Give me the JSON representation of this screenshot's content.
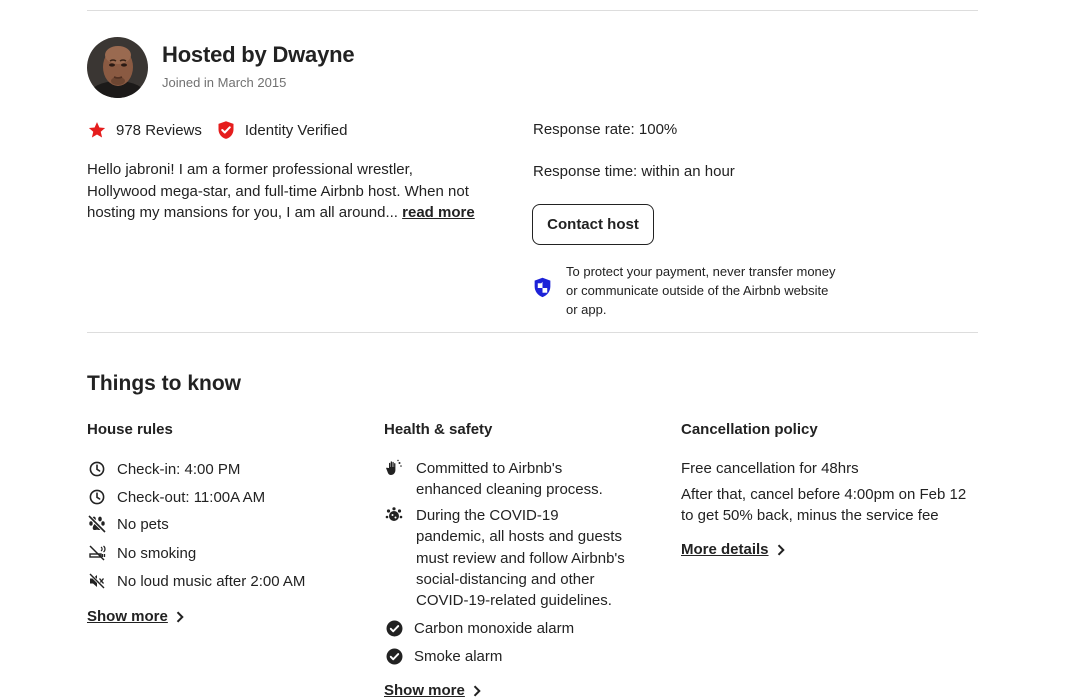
{
  "host": {
    "title": "Hosted by Dwayne",
    "joined": "Joined in March 2015",
    "reviews": "978 Reviews",
    "verified": "Identity Verified",
    "bio": "Hello jabroni! I am a former professional wrestler, Hollywood mega-star, and full-time Airbnb host. When not hosting my mansions for you, I am all around...",
    "read_more": "read more",
    "response_rate": "Response rate: 100%",
    "response_time": "Response time: within an hour",
    "contact_label": "Contact host",
    "payment_note": "To protect your payment, never transfer money or communicate outside of the Airbnb website or app.",
    "colors": {
      "star": "#E51D1D",
      "shield_verified": "#E51D1D",
      "shield_payment": "#1D22D8"
    }
  },
  "things_to_know": {
    "title": "Things to know",
    "house_rules": {
      "title": "House rules",
      "items": [
        {
          "icon": "clock-icon",
          "label": "Check-in: 4:00 PM"
        },
        {
          "icon": "clock-icon",
          "label": "Check-out: 11:00A AM"
        },
        {
          "icon": "no-pets-icon",
          "label": "No pets"
        },
        {
          "icon": "no-smoking-icon",
          "label": "No smoking"
        },
        {
          "icon": "no-music-icon",
          "label": "No loud music after 2:00 AM"
        }
      ],
      "show_more": "Show more"
    },
    "health_safety": {
      "title": "Health & safety",
      "items": [
        {
          "icon": "cleaning-hand-icon",
          "label": "Committed to Airbnb's enhanced cleaning process."
        },
        {
          "icon": "covid-icon",
          "label": "During the COVID-19 pandemic, all hosts and guests must review and follow Airbnb's social-distancing and other COVID-19-related guidelines."
        },
        {
          "icon": "check-circle-icon",
          "label": "Carbon monoxide alarm"
        },
        {
          "icon": "check-circle-icon",
          "label": "Smoke alarm"
        }
      ],
      "show_more": "Show more"
    },
    "cancellation": {
      "title": "Cancellation policy",
      "line1": "Free cancellation for 48hrs",
      "line2": "After that, cancel before 4:00pm on Feb 12 to get 50% back, minus the service fee",
      "more_details": "More details"
    }
  }
}
